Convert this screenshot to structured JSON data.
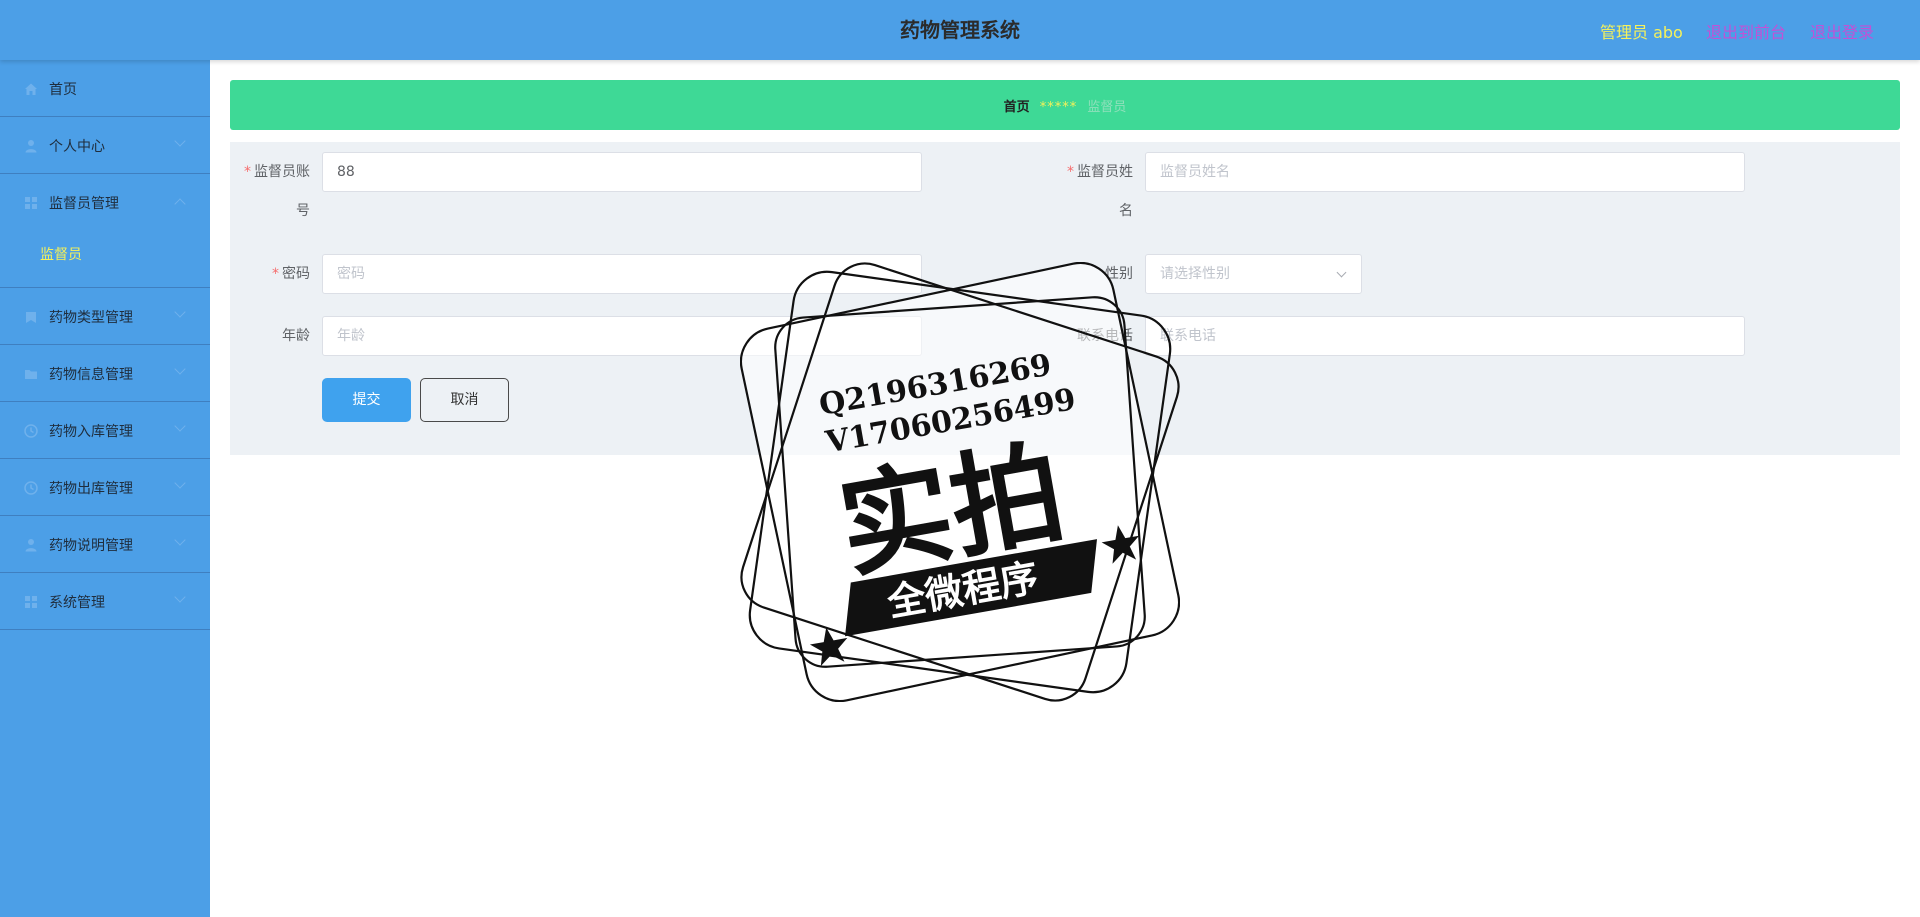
{
  "header": {
    "title": "药物管理系统",
    "user": "管理员 abo",
    "front_link": "退出到前台",
    "logout_link": "退出登录"
  },
  "sidebar": {
    "items": [
      {
        "label": "首页",
        "icon": "home-icon"
      },
      {
        "label": "个人中心",
        "icon": "user-icon"
      },
      {
        "label": "监督员管理",
        "icon": "grid-icon",
        "open": true
      },
      {
        "label": "药物类型管理",
        "icon": "bookmark-icon"
      },
      {
        "label": "药物信息管理",
        "icon": "folder-icon"
      },
      {
        "label": "药物入库管理",
        "icon": "clock-icon"
      },
      {
        "label": "药物出库管理",
        "icon": "clock-icon"
      },
      {
        "label": "药物说明管理",
        "icon": "user-icon"
      },
      {
        "label": "系统管理",
        "icon": "grid-icon"
      }
    ],
    "submenu": {
      "label": "监督员"
    }
  },
  "breadcrumb": {
    "home": "首页",
    "separator": "*****",
    "current": "监督员"
  },
  "form": {
    "account_label_1": "监督员账",
    "account_label_2": "号",
    "account_value": "88",
    "name_label_1": "监督员姓",
    "name_label_2": "名",
    "name_placeholder": "监督员姓名",
    "password_label": "密码",
    "password_placeholder": "密码",
    "gender_label": "性别",
    "gender_placeholder": "请选择性别",
    "age_label": "年龄",
    "age_placeholder": "年龄",
    "phone_label": "联系电话",
    "phone_placeholder": "联系电话",
    "submit_label": "提交",
    "cancel_label": "取消"
  },
  "watermark": {
    "line1": "Q2196316269",
    "line2": "V17060256499",
    "main": "实拍",
    "ribbon": "全微程序"
  },
  "colors": {
    "header_bg": "#4c9fe7",
    "breadcrumb_bg": "#3ed996",
    "accent": "#3fa2ee",
    "highlight_yellow": "#f5f15a",
    "link_purple": "#c251d6"
  }
}
